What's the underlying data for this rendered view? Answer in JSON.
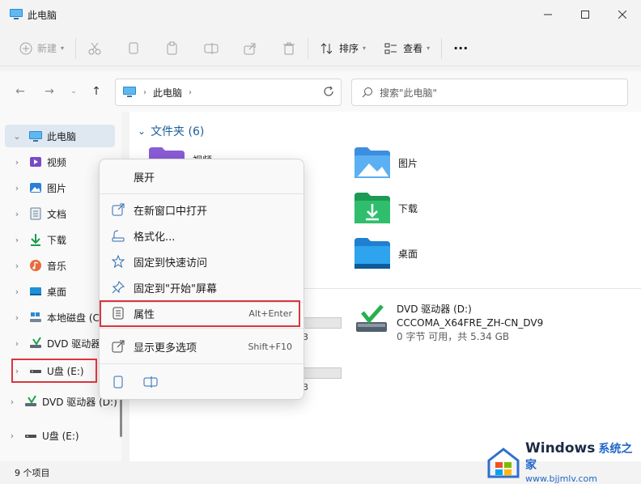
{
  "window": {
    "title": "此电脑"
  },
  "toolbar": {
    "new_label": "新建",
    "sort_label": "排序",
    "view_label": "查看",
    "more_label": "···"
  },
  "address": {
    "crumb": "此电脑",
    "search_placeholder": "搜索\"此电脑\""
  },
  "nav": {
    "items": [
      {
        "label": "此电脑",
        "icon": "monitor-icon"
      },
      {
        "label": "视频",
        "icon": "video-folder-icon"
      },
      {
        "label": "图片",
        "icon": "pictures-folder-icon"
      },
      {
        "label": "文档",
        "icon": "documents-folder-icon"
      },
      {
        "label": "下载",
        "icon": "download-icon"
      },
      {
        "label": "音乐",
        "icon": "music-icon"
      },
      {
        "label": "桌面",
        "icon": "desktop-icon"
      },
      {
        "label": "本地磁盘 (C:)",
        "icon": "local-disk-icon"
      },
      {
        "label": "DVD 驱动器",
        "icon": "dvd-drive-icon"
      },
      {
        "label": "U盘 (E:)",
        "icon": "usb-drive-icon"
      },
      {
        "label": "DVD 驱动器 (D:)",
        "icon": "dvd-drive-icon"
      },
      {
        "label": "U盘 (E:)",
        "icon": "usb-drive-icon"
      }
    ]
  },
  "main": {
    "section_title": "文件夹 (6)",
    "folders": [
      {
        "label": "视频"
      },
      {
        "label": "图片"
      },
      {
        "label": "下载"
      },
      {
        "label": "桌面"
      }
    ],
    "drive": {
      "name": "DVD 驱动器 (D:)",
      "volume": "CCCOMA_X64FRE_ZH-CN_DV9",
      "free": "0 字节 可用，共 5.34 GB"
    },
    "stub_1": "3",
    "stub_2": "3"
  },
  "context_menu": {
    "items": [
      {
        "label": "展开",
        "shortcut": ""
      },
      {
        "label": "在新窗口中打开",
        "shortcut": ""
      },
      {
        "label": "格式化...",
        "shortcut": ""
      },
      {
        "label": "固定到快速访问",
        "shortcut": ""
      },
      {
        "label": "固定到\"开始\"屏幕",
        "shortcut": ""
      },
      {
        "label": "属性",
        "shortcut": "Alt+Enter"
      },
      {
        "label": "显示更多选项",
        "shortcut": "Shift+F10"
      }
    ]
  },
  "status": {
    "count": "9 个项目"
  },
  "watermark": {
    "brand": "Windows",
    "brand_cn": "系统之家",
    "site": "www.bjjmlv.com"
  },
  "colors": {
    "accent": "#1c5e9c",
    "highlight": "#d9363e",
    "selected": "#dfe7f1"
  }
}
